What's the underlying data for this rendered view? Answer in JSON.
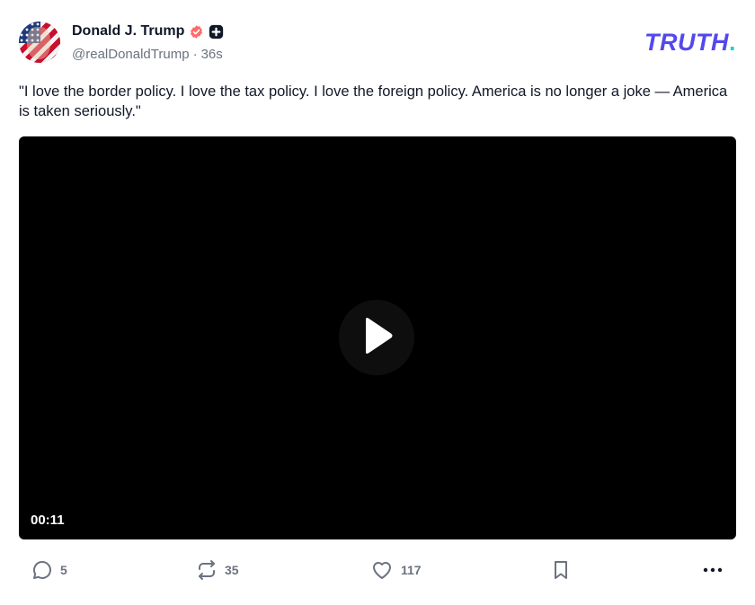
{
  "post": {
    "author": {
      "display_name": "Donald J. Trump",
      "handle": "@realDonaldTrump",
      "separator": "·",
      "time_ago": "36s",
      "verified_icon": "verified-badge-icon",
      "plus_icon": "plus-badge-icon"
    },
    "brand": {
      "name": "TRUTH",
      "dot": "."
    },
    "text": "\"I love the border policy. I love the tax policy. I love the foreign policy. America is no longer a joke — America is taken seriously.\"",
    "video": {
      "duration": "00:11",
      "play_icon": "play-icon"
    },
    "actions": {
      "replies": "5",
      "retruths": "35",
      "likes": "117",
      "bookmark_icon": "bookmark-icon",
      "more_icon": "more-dots-icon"
    }
  },
  "colors": {
    "brand": "#5448ee",
    "brand_accent": "#17d7c3",
    "verified": "#ff6b6b",
    "muted": "#6b7280"
  }
}
